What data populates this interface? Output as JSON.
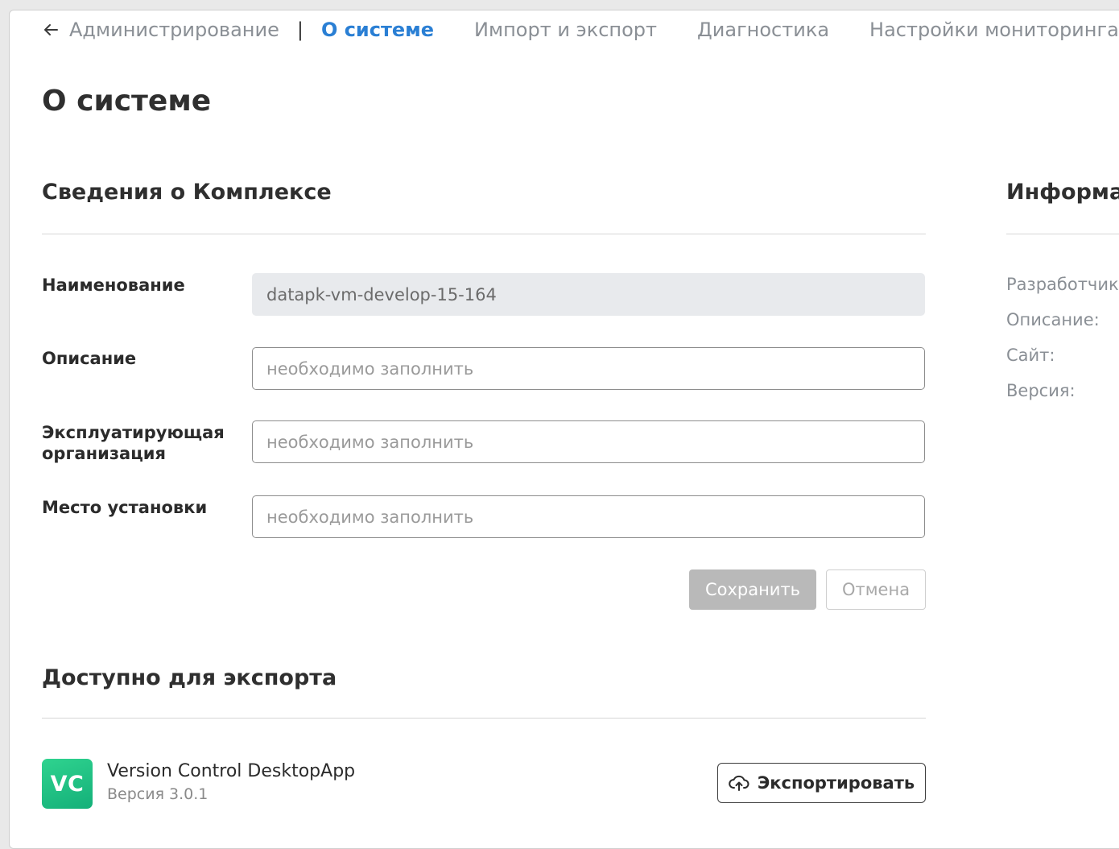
{
  "nav": {
    "back_label": "Администрирование",
    "separator": "|",
    "tabs": [
      {
        "label": "О системе",
        "active": true
      },
      {
        "label": "Импорт и экспорт",
        "active": false
      },
      {
        "label": "Диагностика",
        "active": false
      },
      {
        "label": "Настройки мониторинга",
        "active": false
      }
    ]
  },
  "page": {
    "title": "О системе"
  },
  "complex": {
    "section_title": "Сведения о Комплексе",
    "fields": [
      {
        "label": "Наименование",
        "value": "datapk-vm-develop-15-164",
        "placeholder": "",
        "readonly": true
      },
      {
        "label": "Описание",
        "value": "",
        "placeholder": "необходимо заполнить",
        "readonly": false
      },
      {
        "label": "Эксплуатирующая организация",
        "value": "",
        "placeholder": "необходимо заполнить",
        "readonly": false
      },
      {
        "label": "Место установки",
        "value": "",
        "placeholder": "необходимо заполнить",
        "readonly": false
      }
    ],
    "save_label": "Сохранить",
    "cancel_label": "Отмена"
  },
  "info": {
    "section_title": "Информа",
    "items": [
      "Разработчик",
      "Описание:",
      "Сайт:",
      "Версия:"
    ]
  },
  "export": {
    "section_title": "Доступно для экспорта",
    "app": {
      "logo_text": "VC",
      "name": "Version Control DesktopApp",
      "version": "Версия 3.0.1"
    },
    "export_label": "Экспортировать"
  },
  "colors": {
    "accent": "#2a7fd4",
    "logo_green": "#1fc283",
    "save_disabled": "#b9b9b9"
  },
  "icons": {
    "back": "arrow-left-icon",
    "export": "cloud-upload-icon"
  }
}
